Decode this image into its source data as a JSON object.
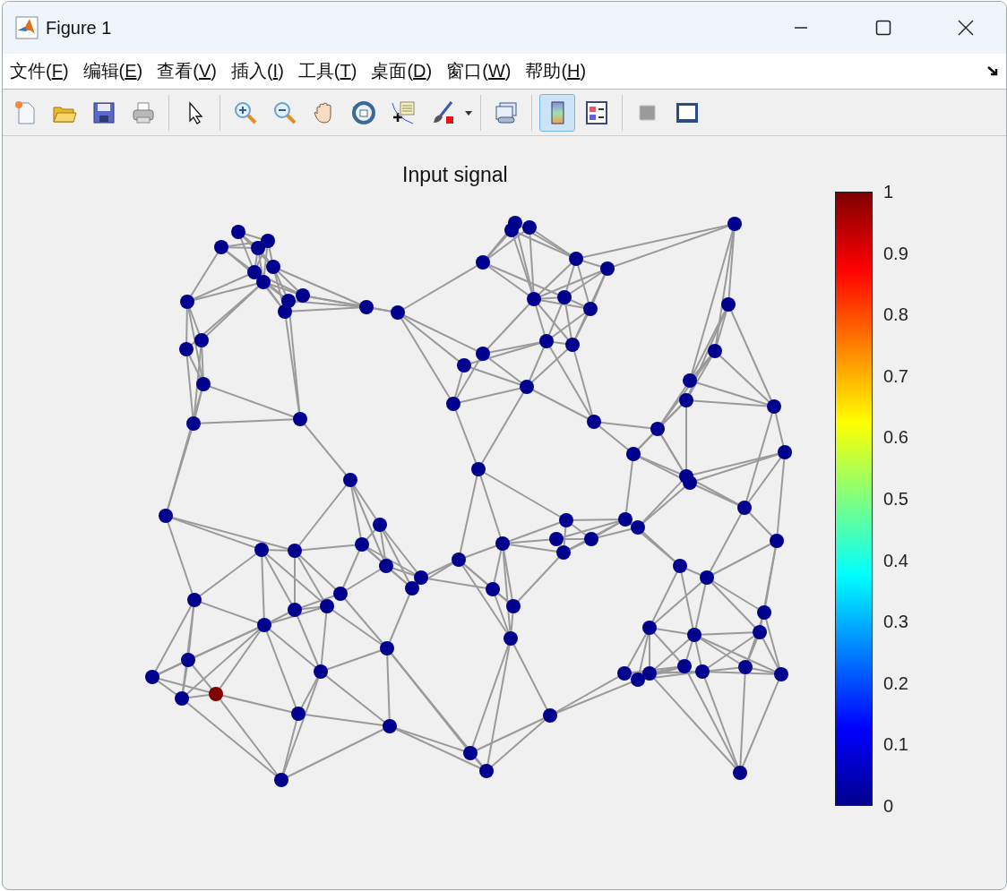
{
  "window": {
    "title": "Figure 1"
  },
  "menu": [
    {
      "label": "文件(F)"
    },
    {
      "label": "编辑(E)"
    },
    {
      "label": "查看(V)"
    },
    {
      "label": "插入(I)"
    },
    {
      "label": "工具(T)"
    },
    {
      "label": "桌面(D)"
    },
    {
      "label": "窗口(W)"
    },
    {
      "label": "帮助(H)"
    }
  ],
  "toolbar": [
    {
      "kind": "new"
    },
    {
      "kind": "open"
    },
    {
      "kind": "save"
    },
    {
      "kind": "print"
    },
    {
      "kind": "separator"
    },
    {
      "kind": "pointer",
      "selected": false
    },
    {
      "kind": "separator"
    },
    {
      "kind": "zoom-in",
      "selected": false
    },
    {
      "kind": "zoom-out",
      "selected": false
    },
    {
      "kind": "pan",
      "selected": false
    },
    {
      "kind": "rotate",
      "selected": false
    },
    {
      "kind": "datatip",
      "selected": false
    },
    {
      "kind": "brush",
      "selected": false
    },
    {
      "kind": "dropdown"
    },
    {
      "kind": "separator"
    },
    {
      "kind": "link",
      "selected": false
    },
    {
      "kind": "separator"
    },
    {
      "kind": "colorbar",
      "selected": true
    },
    {
      "kind": "legend",
      "selected": false
    },
    {
      "kind": "separator"
    },
    {
      "kind": "hide"
    },
    {
      "kind": "property"
    }
  ],
  "axes": {
    "title": "Input signal"
  },
  "colorbar": {
    "ticks": [
      "1",
      "0.9",
      "0.8",
      "0.7",
      "0.6",
      "0.5",
      "0.4",
      "0.3",
      "0.2",
      "0.1",
      "0"
    ]
  }
}
